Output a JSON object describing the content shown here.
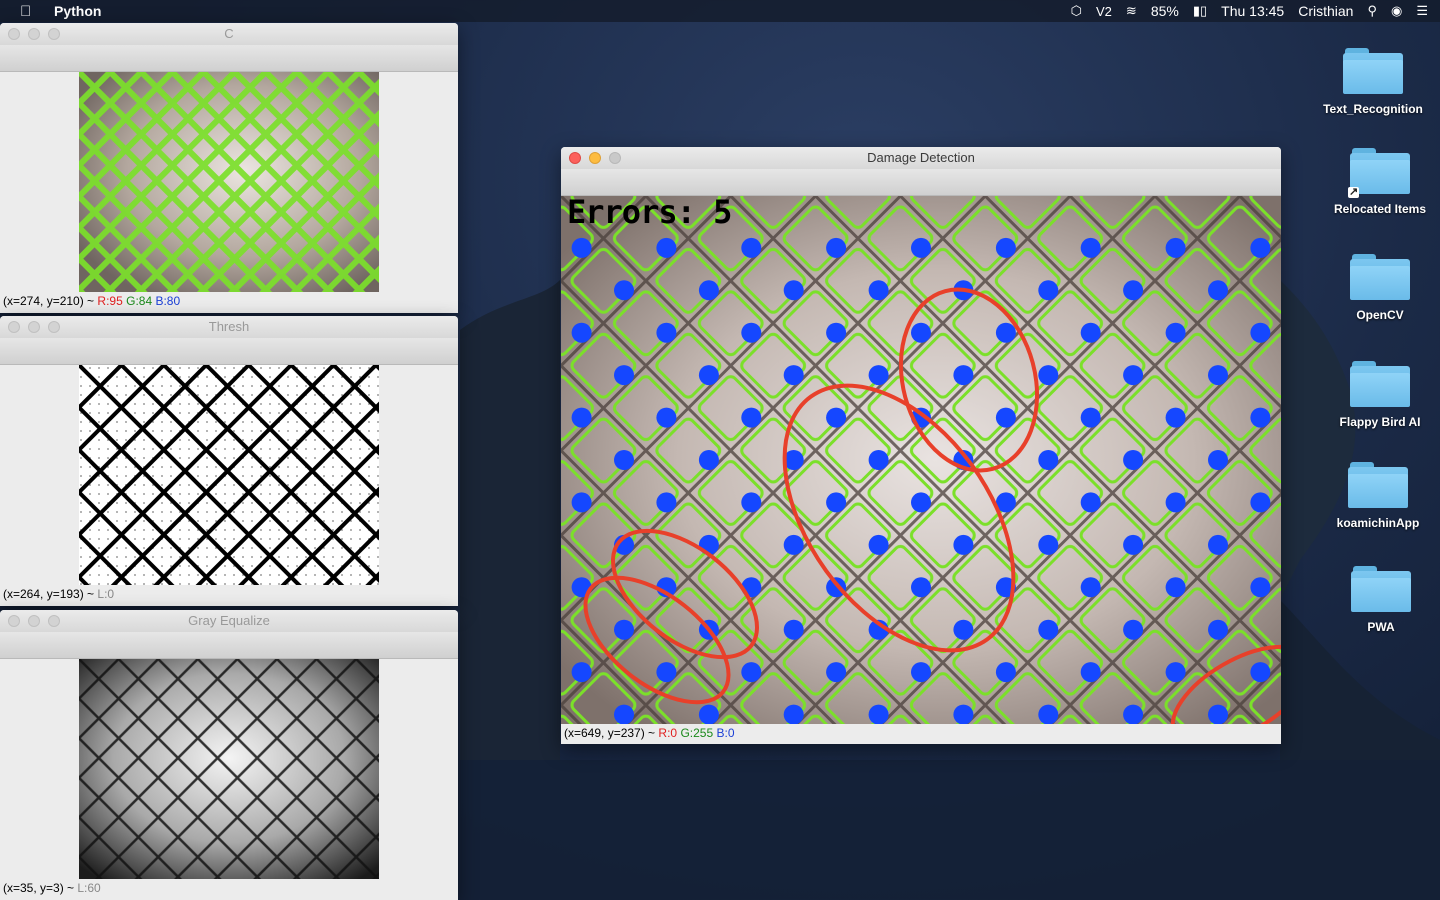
{
  "menubar": {
    "app_name": "Python",
    "battery": "85%",
    "clock": "Thu 13:45",
    "user": "Cristhian",
    "status_icons": [
      "bitdefender-icon",
      "v2-icon",
      "wifi-icon",
      "battery-icon",
      "search-icon",
      "siri-icon",
      "list-icon"
    ]
  },
  "desktop_icons": [
    {
      "label": "Text_Recognition"
    },
    {
      "label": "Relocated Items"
    },
    {
      "label": "OpenCV"
    },
    {
      "label": "Flappy Bird AI"
    },
    {
      "label": "koamichinApp"
    },
    {
      "label": "PWA"
    }
  ],
  "windows": {
    "c": {
      "title": "C",
      "status": {
        "coords": "(x=274, y=210) ~ ",
        "r": "R:95",
        "g": "G:84",
        "b": "B:80"
      }
    },
    "thresh": {
      "title": "Thresh",
      "status": {
        "coords": "(x=264, y=193) ~ ",
        "l": "L:0"
      }
    },
    "gray": {
      "title": "Gray Equalize",
      "status": {
        "coords": "(x=35, y=3) ~ ",
        "l": "L:60"
      }
    },
    "damage": {
      "title": "Damage Detection",
      "overlay_text": "Errors: 5",
      "status": {
        "coords": "(x=649, y=237) ~ ",
        "r": "R:0",
        "g": "G:255",
        "b": "B:0"
      }
    }
  },
  "colors": {
    "contour": "#7be02a",
    "dot": "#1547ff",
    "ellipse": "#e8402a"
  }
}
